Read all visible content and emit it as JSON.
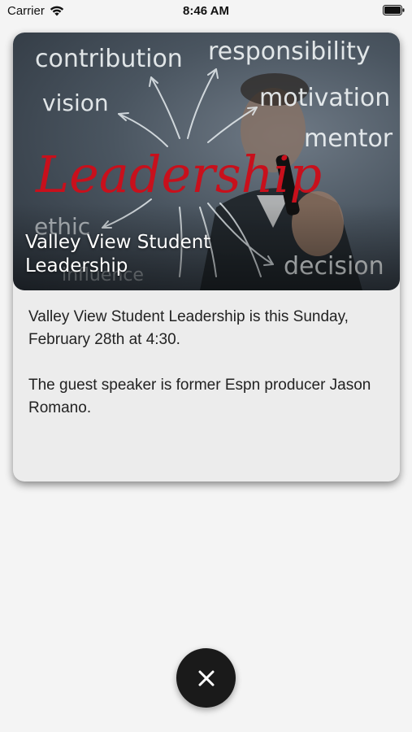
{
  "status_bar": {
    "carrier": "Carrier",
    "time": "8:46 AM",
    "icons": [
      "wifi-icon",
      "battery-icon"
    ]
  },
  "card": {
    "title": "Valley View Student Leadership",
    "image": {
      "words": {
        "contribution": "contribution",
        "responsibility": "responsibility",
        "vision": "vision",
        "motivation": "motivation",
        "mentor": "mentor",
        "leadership": "Leadership",
        "ethic": "ethic",
        "influence": "influence",
        "decision": "decision"
      }
    },
    "paragraphs": [
      "Valley View Student Leadership is this Sunday, February 28th at 4:30.",
      "The guest speaker is former Espn producer Jason Romano."
    ]
  },
  "close_button": {
    "icon": "close-icon",
    "color": "#1a1a1a"
  },
  "colors": {
    "background": "#f4f4f4",
    "card": "#ececec",
    "leadership_red": "#c8101c"
  }
}
